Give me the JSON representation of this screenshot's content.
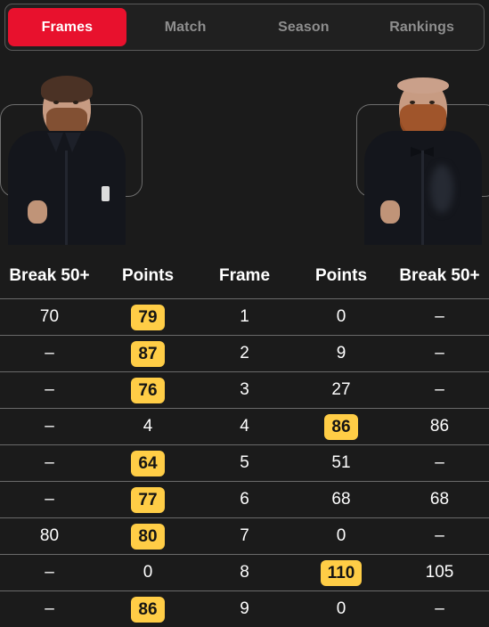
{
  "tabs": [
    {
      "label": "Frames",
      "active": true
    },
    {
      "label": "Match",
      "active": false
    },
    {
      "label": "Season",
      "active": false
    },
    {
      "label": "Rankings",
      "active": false
    }
  ],
  "players": {
    "left": {
      "name": "player-left-photo"
    },
    "right": {
      "name": "player-right-photo"
    }
  },
  "table": {
    "headers": [
      "Break 50+",
      "Points",
      "Frame",
      "Points",
      "Break 50+"
    ],
    "rows": [
      {
        "left_break": "70",
        "left_points": "79",
        "left_win": true,
        "frame": "1",
        "right_points": "0",
        "right_win": false,
        "right_break": "–"
      },
      {
        "left_break": "–",
        "left_points": "87",
        "left_win": true,
        "frame": "2",
        "right_points": "9",
        "right_win": false,
        "right_break": "–"
      },
      {
        "left_break": "–",
        "left_points": "76",
        "left_win": true,
        "frame": "3",
        "right_points": "27",
        "right_win": false,
        "right_break": "–"
      },
      {
        "left_break": "–",
        "left_points": "4",
        "left_win": false,
        "frame": "4",
        "right_points": "86",
        "right_win": true,
        "right_break": "86"
      },
      {
        "left_break": "–",
        "left_points": "64",
        "left_win": true,
        "frame": "5",
        "right_points": "51",
        "right_win": false,
        "right_break": "–"
      },
      {
        "left_break": "–",
        "left_points": "77",
        "left_win": true,
        "frame": "6",
        "right_points": "68",
        "right_win": false,
        "right_break": "68"
      },
      {
        "left_break": "80",
        "left_points": "80",
        "left_win": true,
        "frame": "7",
        "right_points": "0",
        "right_win": false,
        "right_break": "–"
      },
      {
        "left_break": "–",
        "left_points": "0",
        "left_win": false,
        "frame": "8",
        "right_points": "110",
        "right_win": true,
        "right_break": "105"
      },
      {
        "left_break": "–",
        "left_points": "86",
        "left_win": true,
        "frame": "9",
        "right_points": "0",
        "right_win": false,
        "right_break": "–"
      }
    ]
  },
  "colors": {
    "accent_red": "#E8112D",
    "highlight_yellow": "#FFCD46",
    "background": "#1B1B1B",
    "divider": "#6A6A6A"
  }
}
